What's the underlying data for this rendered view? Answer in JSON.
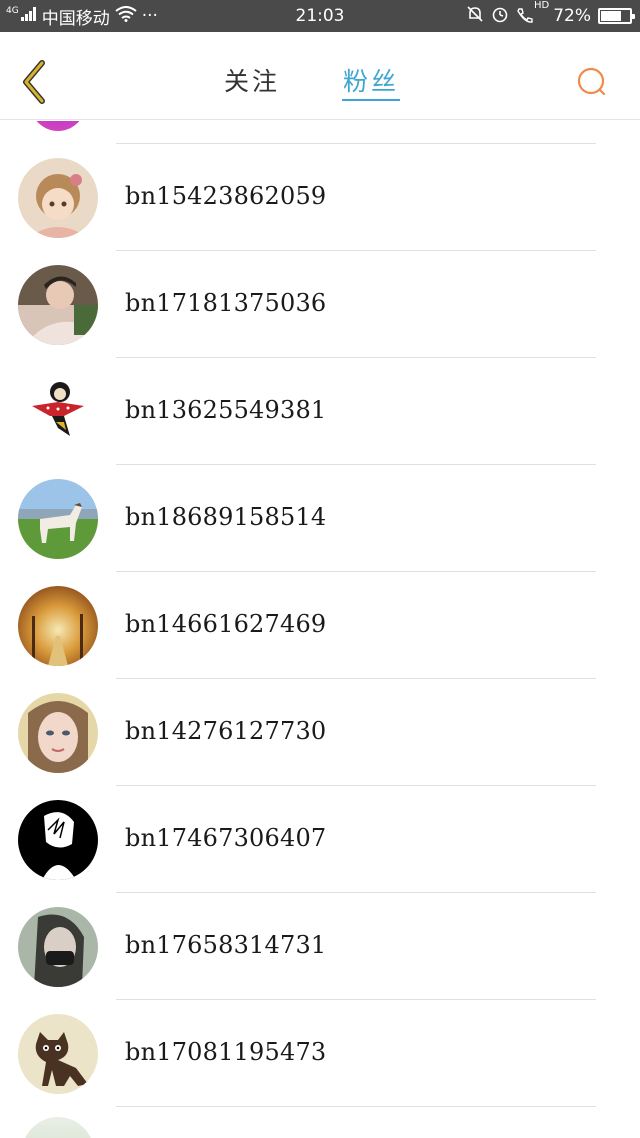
{
  "status_bar": {
    "network": "4G",
    "carrier": "中国移动",
    "more": "···",
    "time": "21:03",
    "hd": "HD",
    "battery": "72%",
    "battery_level": 0.72
  },
  "header": {
    "tabs": [
      {
        "label": "关注",
        "active": false
      },
      {
        "label": "粉丝",
        "active": true
      }
    ],
    "accent_color": "#3fa6d2",
    "back_color": "#d8b32a",
    "search_color": "#f0894a"
  },
  "fans": [
    {
      "name": "bn15423862059",
      "avatar": "doll-avatar"
    },
    {
      "name": "bn17181375036",
      "avatar": "man-avatar"
    },
    {
      "name": "bn13625549381",
      "avatar": "cartoon-bird-avatar"
    },
    {
      "name": "bn18689158514",
      "avatar": "horse-avatar"
    },
    {
      "name": "bn14661627469",
      "avatar": "autumn-trees-avatar"
    },
    {
      "name": "bn14276127730",
      "avatar": "girl-avatar"
    },
    {
      "name": "bn17467306407",
      "avatar": "anime-boy-avatar"
    },
    {
      "name": "bn17658314731",
      "avatar": "masked-girl-avatar"
    },
    {
      "name": "bn17081195473",
      "avatar": "cat-avatar"
    }
  ]
}
